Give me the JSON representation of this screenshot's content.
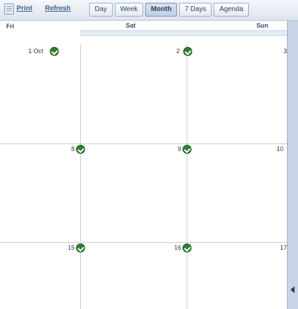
{
  "toolbar": {
    "print_label": "Print",
    "refresh_label": "Refresh",
    "views": [
      "Day",
      "Week",
      "Month",
      "7 Days",
      "Agenda"
    ],
    "active_view": "Month"
  },
  "day_header": {
    "fri": "Fri",
    "sat": "Sat",
    "sun": "Sun"
  },
  "weeks": [
    [
      "1 Oct",
      "2",
      "3"
    ],
    [
      "8",
      "9",
      "10"
    ],
    [
      "15",
      "16",
      "17"
    ]
  ]
}
